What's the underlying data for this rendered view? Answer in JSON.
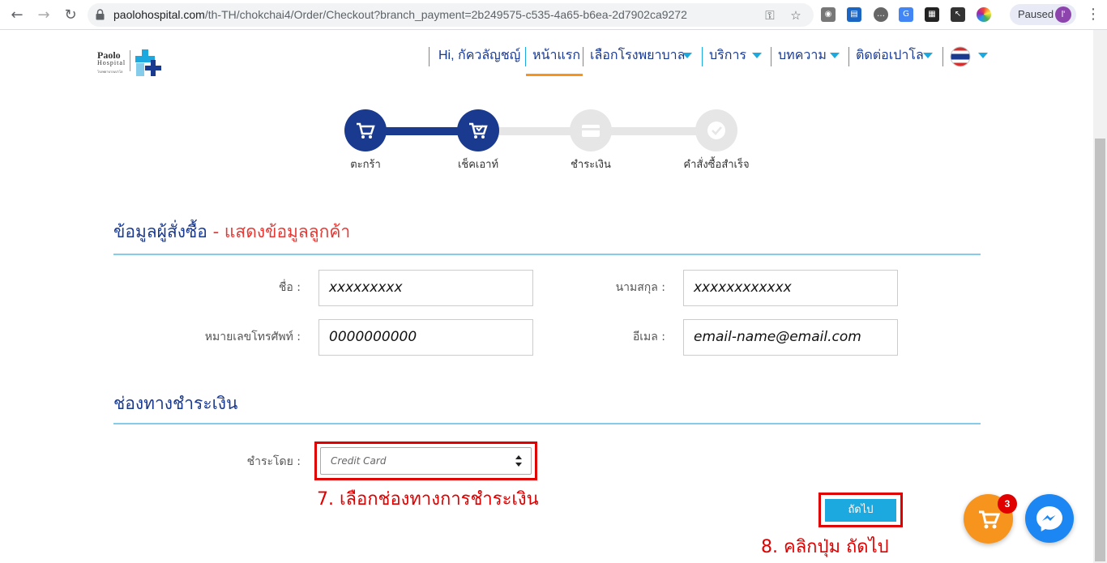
{
  "browser": {
    "url_domain": "paolohospital.com",
    "url_path": "/th-TH/chokchai4/Order/Checkout?branch_payment=2b249575-c535-4a65-b6ea-2d7902ca9272",
    "profile_status": "Paused",
    "profile_initial": "l'"
  },
  "logo": {
    "line1": "Paolo",
    "line2": "Hospital",
    "sub": "โรงพยาบาลเปาโล"
  },
  "nav": {
    "greeting": "Hi, กัควลัญชญ์",
    "home": "หน้าแรก",
    "choose_hospital": "เลือกโรงพยาบาล",
    "services": "บริการ",
    "articles": "บทความ",
    "contact": "ติดต่อเปาโล"
  },
  "steps": [
    {
      "label": "ตะกร้า",
      "state": "done"
    },
    {
      "label": "เช็คเอาท์",
      "state": "current"
    },
    {
      "label": "ชำระเงิน",
      "state": "pending"
    },
    {
      "label": "คำสั่งซื้อสำเร็จ",
      "state": "pending"
    }
  ],
  "buyer_section": {
    "title": "ข้อมูลผู้สั่งซื้อ",
    "annotation": " - แสดงข้อมูลลูกค้า"
  },
  "form": {
    "first_name_label": "ชื่อ :",
    "first_name_value": "xxxxxxxxx",
    "last_name_label": "นามสกุล :",
    "last_name_value": "xxxxxxxxxxxx",
    "phone_label": "หมายเลขโทรศัพท์ :",
    "phone_value": "0000000000",
    "email_label": "อีเมล :",
    "email_value": "email-name@email.com"
  },
  "payment_section": {
    "title": "ช่องทางชำระเงิน",
    "pay_by_label": "ชำระโดย :",
    "pay_by_value": "Credit Card",
    "annotation_select": "7. เลือกช่องทางการชำระเงิน",
    "next_button": "ถัดไป",
    "annotation_next": "8. คลิกปุ่ม ถัดไป"
  },
  "cart": {
    "count": "3"
  },
  "colors": {
    "navy": "#1a3a8f",
    "brand_blue": "#1ba9df",
    "orange": "#f7941d",
    "annotation_red": "#e00000",
    "step_inactive": "#e6e6e6"
  }
}
